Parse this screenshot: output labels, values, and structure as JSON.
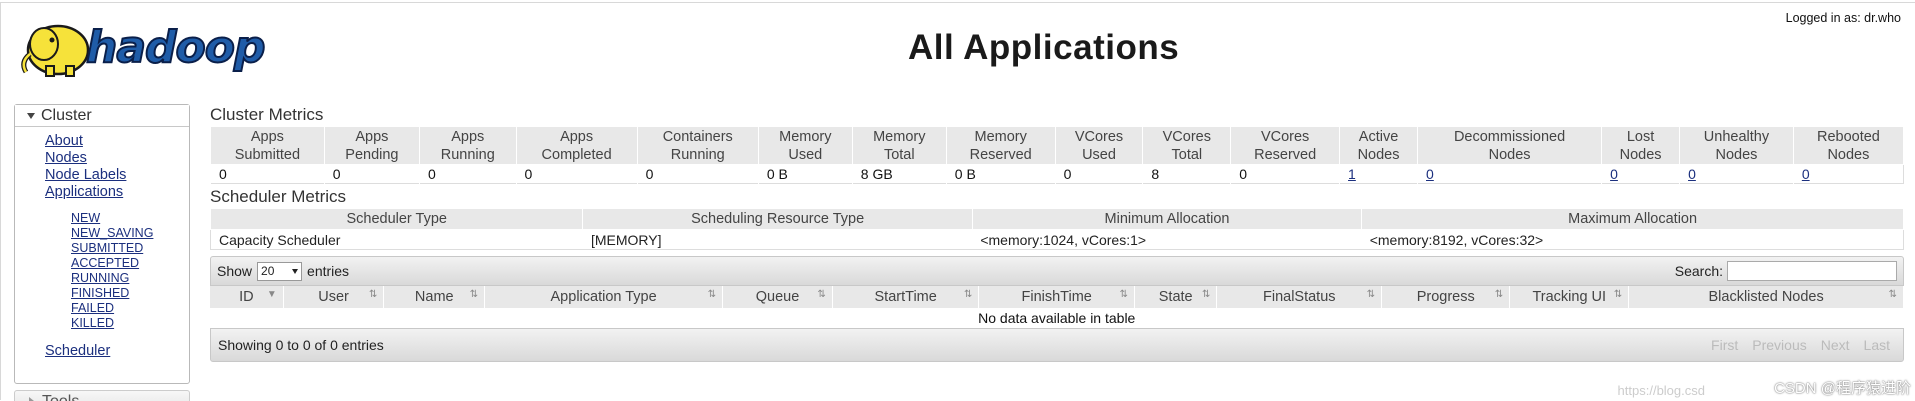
{
  "header": {
    "logo_text": "hadoop",
    "title": "All Applications",
    "logged_in": "Logged in as: dr.who"
  },
  "sidebar": {
    "cluster_label": "Cluster",
    "links": [
      "About",
      "Nodes",
      "Node Labels",
      "Applications"
    ],
    "app_states": [
      "NEW",
      "NEW_SAVING",
      "SUBMITTED",
      "ACCEPTED",
      "RUNNING",
      "FINISHED",
      "FAILED",
      "KILLED"
    ],
    "scheduler": "Scheduler",
    "tools_label": "Tools"
  },
  "cluster_metrics": {
    "title": "Cluster Metrics",
    "headers": [
      [
        "Apps",
        "Submitted"
      ],
      [
        "Apps",
        "Pending"
      ],
      [
        "Apps",
        "Running"
      ],
      [
        "Apps",
        "Completed"
      ],
      [
        "Containers",
        "Running"
      ],
      [
        "Memory",
        "Used"
      ],
      [
        "Memory",
        "Total"
      ],
      [
        "Memory",
        "Reserved"
      ],
      [
        "VCores",
        "Used"
      ],
      [
        "VCores",
        "Total"
      ],
      [
        "VCores",
        "Reserved"
      ],
      [
        "Active",
        "Nodes"
      ],
      [
        "Decommissioned",
        "Nodes"
      ],
      [
        "Lost",
        "Nodes"
      ],
      [
        "Unhealthy",
        "Nodes"
      ],
      [
        "Rebooted",
        "Nodes"
      ]
    ],
    "values": [
      "0",
      "0",
      "0",
      "0",
      "0",
      "0 B",
      "8 GB",
      "0 B",
      "0",
      "8",
      "0",
      "1",
      "0",
      "0",
      "0",
      "0"
    ]
  },
  "scheduler_metrics": {
    "title": "Scheduler Metrics",
    "headers": [
      "Scheduler Type",
      "Scheduling Resource Type",
      "Minimum Allocation",
      "Maximum Allocation"
    ],
    "values": [
      "Capacity Scheduler",
      "[MEMORY]",
      "<memory:1024, vCores:1>",
      "<memory:8192, vCores:32>"
    ]
  },
  "apps_table": {
    "show_label": "Show",
    "entries_label": "entries",
    "page_length": "20",
    "search_label": "Search:",
    "columns": [
      "ID",
      "User",
      "Name",
      "Application Type",
      "Queue",
      "StartTime",
      "FinishTime",
      "State",
      "FinalStatus",
      "Progress",
      "Tracking UI",
      "Blacklisted Nodes"
    ],
    "empty_message": "No data available in table",
    "info": "Showing 0 to 0 of 0 entries",
    "pager": [
      "First",
      "Previous",
      "Next",
      "Last"
    ]
  },
  "watermark": "CSDN @程序猿进阶",
  "watermark_url": "https://blog.csd"
}
